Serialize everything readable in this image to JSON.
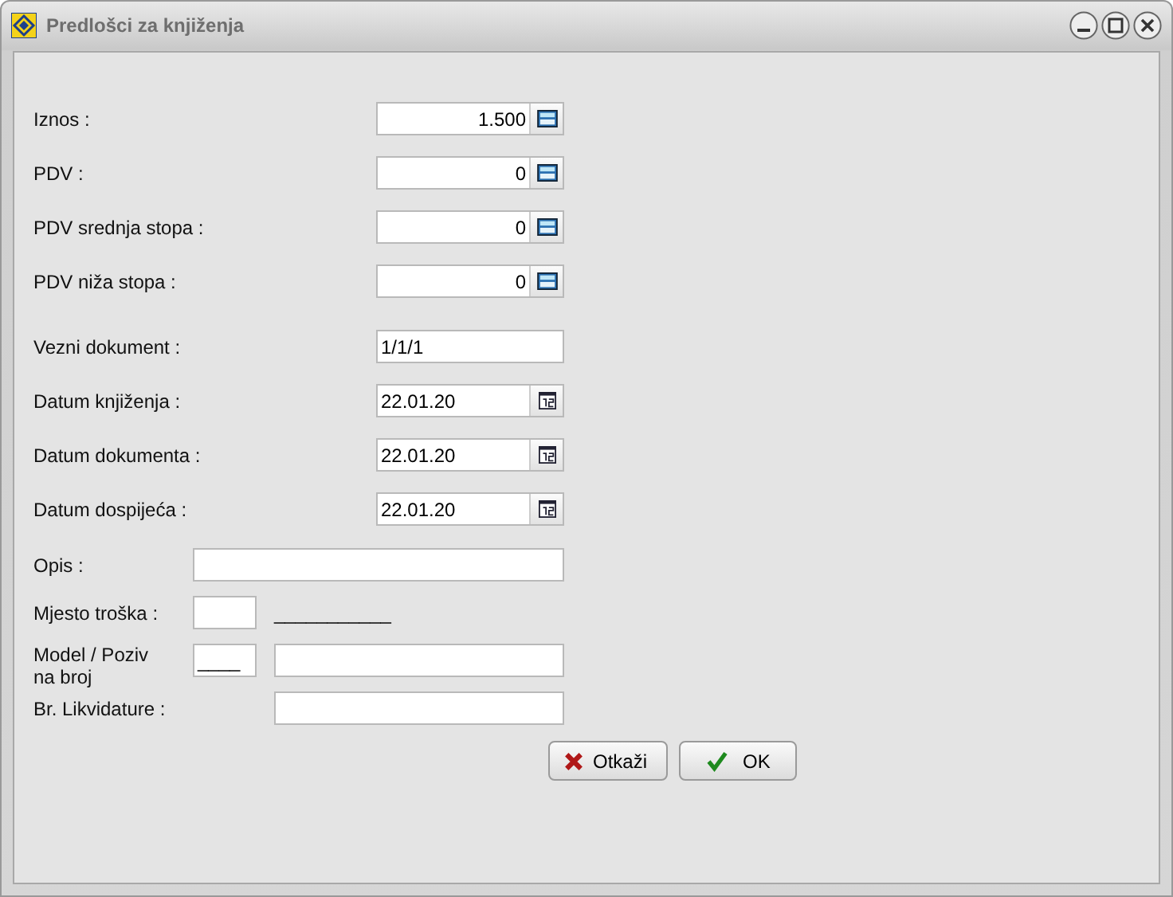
{
  "window": {
    "title": "Predlošci za knjiženja"
  },
  "groups": [
    [
      {
        "kind": "amount",
        "label": "Iznos :",
        "value": "1.500"
      },
      {
        "kind": "amount",
        "label": "PDV :",
        "value": "0"
      },
      {
        "kind": "amount",
        "label": "PDV srednja stopa :",
        "value": "0"
      },
      {
        "kind": "amount",
        "label": "PDV niža stopa :",
        "value": "0"
      }
    ],
    [
      {
        "kind": "text",
        "label": "Vezni dokument :",
        "value": "1/1/1"
      },
      {
        "kind": "date",
        "label": "Datum knjiženja :",
        "value": "22.01.20"
      },
      {
        "kind": "date",
        "label": "Datum dokumenta :",
        "value": "22.01.20"
      },
      {
        "kind": "date",
        "label": "Datum dospijeća :",
        "value": "22.01.20"
      }
    ],
    [
      {
        "kind": "wide",
        "label": "Opis :"
      },
      {
        "kind": "cost",
        "label": "Mjesto troška :",
        "note": "___________"
      },
      {
        "kind": "model",
        "label": "Model / Poziv na broj",
        "value": "____"
      },
      {
        "kind": "plain",
        "label": "Br. Likvidature :"
      }
    ]
  ],
  "buttons": [
    {
      "kind": "cancel",
      "label": "Otkaži"
    },
    {
      "kind": "ok",
      "label": "OK"
    }
  ]
}
